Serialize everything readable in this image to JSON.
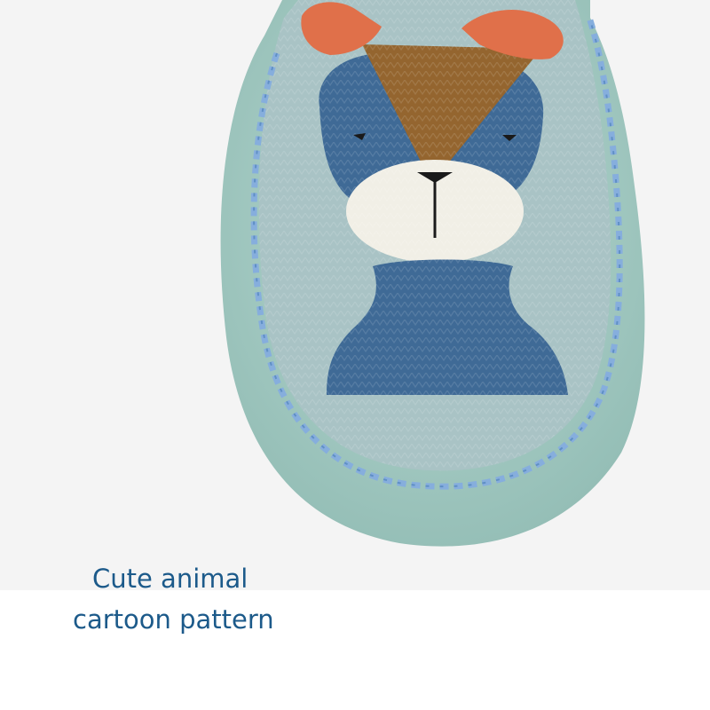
{
  "product_photo": {
    "subject": "baby-sock-shoe-with-animal-face",
    "colors": {
      "background": "#f4f4f4",
      "sole": "#a9cfc8",
      "knit_light": "#a9c3c5",
      "knit_blue": "#3f6a96",
      "knit_brown": "#94652f",
      "ears": "#e0704a",
      "muzzle": "#f1efe6",
      "stitching": "#86aedd"
    }
  },
  "caption": {
    "line1": "Cute animal",
    "line2": "cartoon pattern",
    "color": "#1c5a8a"
  }
}
